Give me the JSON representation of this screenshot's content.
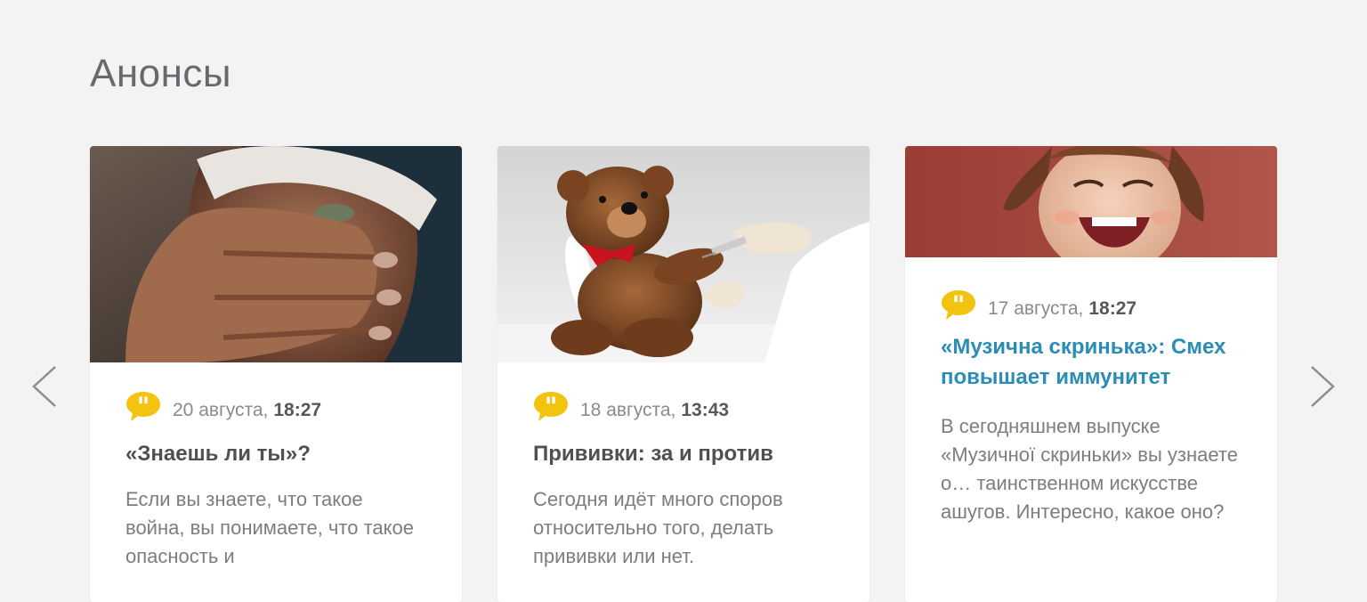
{
  "section": {
    "title": "Анонсы"
  },
  "colors": {
    "background": "#f3f3f3",
    "card": "#ffffff",
    "accent_title": "#2a8db5",
    "quote_icon": "#f2c40f"
  },
  "navigation": {
    "prev_icon": "chevron-left-icon",
    "next_icon": "chevron-right-icon"
  },
  "cards": [
    {
      "image": "photo-wounded-woman",
      "icon": "quote-icon",
      "date": "20 августа,",
      "time": "18:27",
      "title": "«Знаешь ли ты»?",
      "excerpt": "Если вы знаете, что такое война, вы понимаете, что такое опасность и"
    },
    {
      "image": "photo-teddy-bear-vaccine",
      "icon": "quote-icon",
      "date": "18 августа,",
      "time": "13:43",
      "title": "Прививки: за и против",
      "excerpt": "Сегодня идёт много споров относительно того, делать прививки или нет."
    },
    {
      "image": "photo-laughing-child",
      "icon": "quote-icon",
      "date": "17 августа,",
      "time": "18:27",
      "title": "«Музична скринька»: Смех повышает иммунитет",
      "excerpt": "В сегодняшнем выпуске «Музичної скриньки» вы узнаете о… таинственном искусстве ашугов. Интересно, какое оно?"
    }
  ]
}
